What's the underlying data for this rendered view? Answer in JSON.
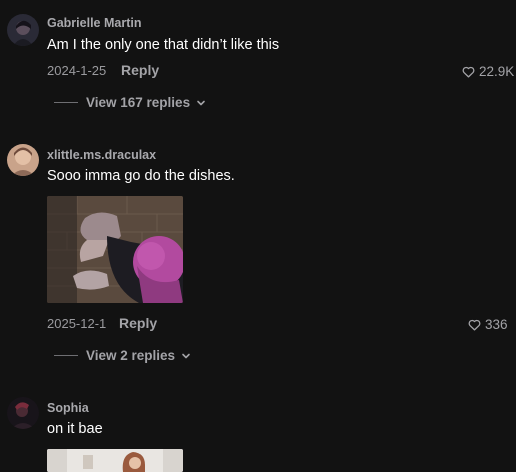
{
  "comments": [
    {
      "username": "Gabrielle Martin",
      "text": "Am I the only one that didn’t like this",
      "date": "2024-1-25",
      "reply_label": "Reply",
      "likes": "22.9K",
      "view_replies": "View 167 replies",
      "avatar_icon": "profile-photo"
    },
    {
      "username": "xlittle.ms.draculax",
      "text": "Sooo imma go do the dishes.",
      "date": "2025-12-1",
      "reply_label": "Reply",
      "likes": "336",
      "view_replies": "View 2 replies",
      "avatar_icon": "profile-photo",
      "media_icon": "animated-gif-thumbnail"
    },
    {
      "username": "Sophia",
      "text": "on it bae",
      "avatar_icon": "profile-photo",
      "media_icon": "image-thumbnail"
    }
  ],
  "icons": {
    "like": "heart-outline-icon",
    "expand": "chevron-down-icon"
  },
  "colors": {
    "background": "#121212",
    "username": "#a9a9ad",
    "secondary_text": "#9a9a9e",
    "primary_text": "#ffffff"
  }
}
